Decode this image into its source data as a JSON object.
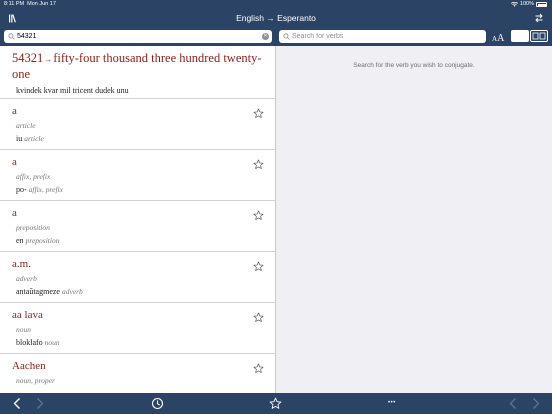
{
  "status_bar": {
    "time": "8:11 PM",
    "date": "Mon Jun 17",
    "battery": "100%"
  },
  "nav": {
    "title": "English → Esperanto"
  },
  "search": {
    "query": "54321",
    "verb_placeholder": "Search for verbs"
  },
  "font_size_button": {
    "small": "A",
    "big": "A"
  },
  "number_entry": {
    "number": "54321",
    "arrow": "→",
    "words": "fifty-four thousand three hundred twenty-one",
    "translation": "kvindek kvar mil tricent dudek unu"
  },
  "entries": [
    {
      "headword": "a",
      "pos": "article",
      "translation": "iu",
      "translation_pos": "article"
    },
    {
      "headword": "a",
      "pos": "affix, prefix",
      "translation": "po-",
      "translation_pos": "affix, prefix"
    },
    {
      "headword": "a",
      "pos": "preposition",
      "translation": "en",
      "translation_pos": "preposition"
    },
    {
      "headword": "a.m.",
      "pos": "adverb",
      "translation": "antaŭtagmeze",
      "translation_pos": "adverb"
    },
    {
      "headword": "aa lava",
      "pos": "noun",
      "translation": "bloklafo",
      "translation_pos": "noun"
    },
    {
      "headword": "Aachen",
      "pos": "noun, proper",
      "translation": "",
      "translation_pos": ""
    }
  ],
  "conjugation": {
    "hint": "Search for the verb you wish to conjugate."
  },
  "toolbar": {
    "more": "•••"
  },
  "colors": {
    "bar": "#2b4466",
    "headword": "#8b1f17",
    "pane_bg": "#efeff4"
  }
}
